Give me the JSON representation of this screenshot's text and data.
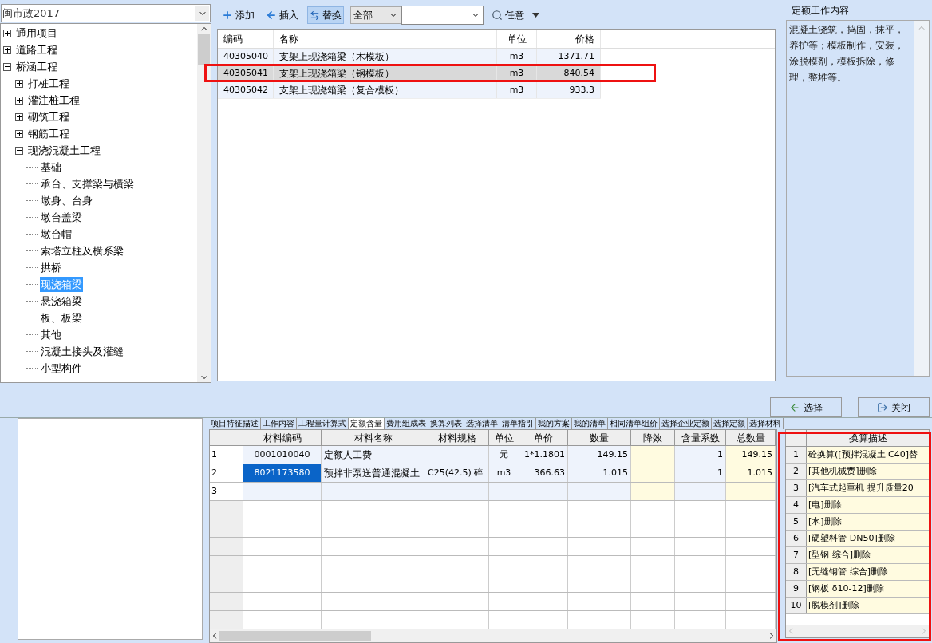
{
  "library_select": {
    "value": "闽市政2017"
  },
  "tree": [
    {
      "label": "通用项目",
      "kind": "branch",
      "expanded": false,
      "selected": false
    },
    {
      "label": "道路工程",
      "kind": "branch",
      "expanded": false,
      "selected": false
    },
    {
      "label": "桥涵工程",
      "kind": "branch",
      "expanded": true,
      "selected": false,
      "children": [
        {
          "label": "打桩工程",
          "kind": "branch",
          "expanded": false,
          "selected": false
        },
        {
          "label": "灌注桩工程",
          "kind": "branch",
          "expanded": false,
          "selected": false
        },
        {
          "label": "砌筑工程",
          "kind": "branch",
          "expanded": false,
          "selected": false
        },
        {
          "label": "钢筋工程",
          "kind": "branch",
          "expanded": false,
          "selected": false
        },
        {
          "label": "现浇混凝土工程",
          "kind": "branch",
          "expanded": true,
          "selected": false,
          "children": [
            {
              "label": "基础",
              "kind": "leaf",
              "selected": false
            },
            {
              "label": "承台、支撑梁与横梁",
              "kind": "leaf",
              "selected": false
            },
            {
              "label": "墩身、台身",
              "kind": "leaf",
              "selected": false
            },
            {
              "label": "墩台盖梁",
              "kind": "leaf",
              "selected": false
            },
            {
              "label": "墩台帽",
              "kind": "leaf",
              "selected": false
            },
            {
              "label": "索塔立柱及横系梁",
              "kind": "leaf",
              "selected": false
            },
            {
              "label": "拱桥",
              "kind": "leaf",
              "selected": false
            },
            {
              "label": "现浇箱梁",
              "kind": "leaf",
              "selected": true
            },
            {
              "label": "悬浇箱梁",
              "kind": "leaf",
              "selected": false
            },
            {
              "label": "板、板梁",
              "kind": "leaf",
              "selected": false
            },
            {
              "label": "其他",
              "kind": "leaf",
              "selected": false
            },
            {
              "label": "混凝土接头及灌缝",
              "kind": "leaf",
              "selected": false
            },
            {
              "label": "小型构件",
              "kind": "leaf",
              "selected": false
            }
          ]
        }
      ]
    }
  ],
  "toolbar": {
    "buttons": [
      {
        "label": "添加",
        "kind": "add",
        "selected": false
      },
      {
        "label": "插入",
        "kind": "insert",
        "selected": false
      },
      {
        "label": "替换",
        "kind": "replace",
        "selected": true
      }
    ],
    "filter_select": {
      "value": "全部"
    },
    "search_button": {
      "label": "任意"
    }
  },
  "quota_table": {
    "columns": [
      "编码",
      "名称",
      "单位",
      "价格"
    ],
    "rows": [
      {
        "cells": [
          "40305040",
          "支架上现浇箱梁（木模板）",
          "m3",
          "1371.71"
        ],
        "selected": false
      },
      {
        "cells": [
          "40305041",
          "支架上现浇箱梁（钢模板）",
          "m3",
          "840.54"
        ],
        "selected": true
      },
      {
        "cells": [
          "40305042",
          "支架上现浇箱梁（复合模板）",
          "m3",
          "933.3"
        ],
        "selected": false
      }
    ]
  },
  "work_content": {
    "title": "定额工作内容",
    "text": "混凝土浇筑，捣固，抹平，养护等；模板制作，安装，涂脱模剂，模板拆除，修理，整堆等。"
  },
  "dialog_buttons": [
    {
      "label": "选择",
      "kind": "select"
    },
    {
      "label": "关闭",
      "kind": "close"
    }
  ],
  "bottom_tabs": [
    {
      "label": "项目特征描述",
      "selected": false
    },
    {
      "label": "工作内容",
      "selected": false
    },
    {
      "label": "工程量计算式",
      "selected": false
    },
    {
      "label": "定额含量",
      "selected": true
    },
    {
      "label": "费用组成表",
      "selected": false
    },
    {
      "label": "换算列表",
      "selected": false
    },
    {
      "label": "选择清单",
      "selected": false
    },
    {
      "label": "清单指引",
      "selected": false
    },
    {
      "label": "我的方案",
      "selected": false
    },
    {
      "label": "我的清单",
      "selected": false
    },
    {
      "label": "相同清单组价",
      "selected": false
    },
    {
      "label": "选择企业定额",
      "selected": false
    },
    {
      "label": "选择定额",
      "selected": false
    },
    {
      "label": "选择材料",
      "selected": false
    }
  ],
  "material_grid": {
    "columns": [
      {
        "label": "材料编码",
        "highlighted": false
      },
      {
        "label": "材料名称",
        "highlighted": false
      },
      {
        "label": "材料规格",
        "highlighted": false
      },
      {
        "label": "单位",
        "highlighted": false
      },
      {
        "label": "单价",
        "highlighted": false
      },
      {
        "label": "数量",
        "highlighted": false
      },
      {
        "label": "降效",
        "highlighted": true
      },
      {
        "label": "含量系数",
        "highlighted": false
      },
      {
        "label": "总数量",
        "highlighted": true
      }
    ],
    "rows": [
      {
        "number": "1",
        "selected": false,
        "cells": [
          "0001010040",
          "定额人工费",
          "",
          "元",
          "1*1.1801",
          "149.15",
          "",
          "1",
          "149.15"
        ]
      },
      {
        "number": "2",
        "selected": true,
        "cells": [
          "8021173580",
          "预拌非泵送普通混凝土",
          "C25(42.5) 碎",
          "m3",
          "366.63",
          "1.015",
          "",
          "1",
          "1.015"
        ]
      },
      {
        "number": "3",
        "selected": false,
        "cells": [
          "",
          "",
          "",
          "",
          "",
          "",
          "",
          "",
          ""
        ]
      }
    ]
  },
  "conversion_list": {
    "column": "换算描述",
    "rows": [
      {
        "number": "1",
        "text": "砼换算([预拌混凝土 C40]替"
      },
      {
        "number": "2",
        "text": "[其他机械费]删除"
      },
      {
        "number": "3",
        "text": "[汽车式起重机 提升质量20"
      },
      {
        "number": "4",
        "text": "[电]删除"
      },
      {
        "number": "5",
        "text": "[水]删除"
      },
      {
        "number": "6",
        "text": "[硬塑料管 DN50]删除"
      },
      {
        "number": "7",
        "text": "[型钢 综合]删除"
      },
      {
        "number": "8",
        "text": "[无缝钢管 综合]删除"
      },
      {
        "number": "9",
        "text": "[钢板 δ10-12]删除"
      },
      {
        "number": "10",
        "text": "[脱模剂]删除"
      }
    ]
  }
}
